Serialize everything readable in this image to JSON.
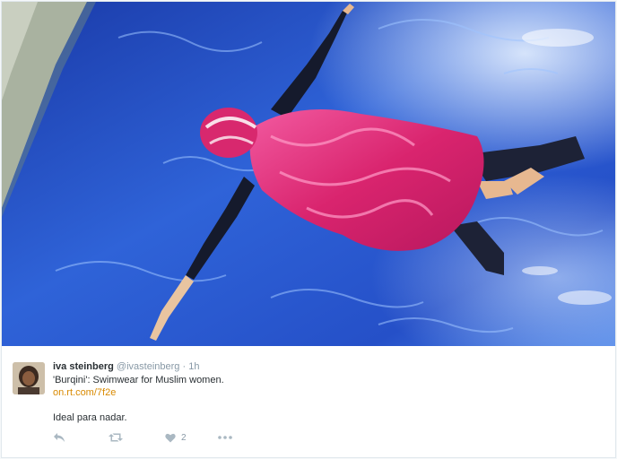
{
  "tweet": {
    "fullname": "iva steinberg",
    "handle": "@ivasteinberg",
    "separator": "·",
    "time": "1h",
    "text": "'Burqini': Swimwear for Muslim women.",
    "link": "on.rt.com/7f2e",
    "comment": "Ideal para nadar.",
    "like_count": "2"
  },
  "icons": {
    "reply": "reply-icon",
    "retweet": "retweet-icon",
    "like": "heart-icon",
    "more": "more-icon"
  },
  "colors": {
    "water": "#1d3fb0",
    "swimsuit": "#e0307a",
    "link": "#d98a00",
    "action": "#aab8c2"
  }
}
